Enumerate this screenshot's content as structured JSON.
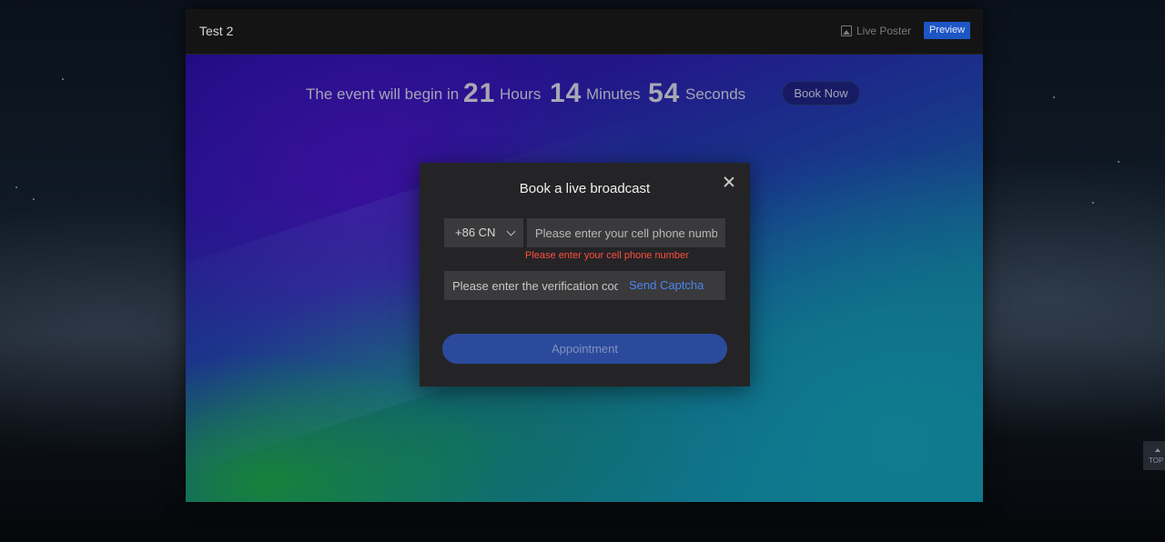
{
  "header": {
    "title": "Test 2",
    "poster_label": "Live Poster",
    "preview_label": "Preview"
  },
  "countdown": {
    "lead": "The event will begin in",
    "hours": "21",
    "hours_label": "Hours",
    "minutes": "14",
    "minutes_label": "Minutes",
    "seconds": "54",
    "seconds_label": "Seconds",
    "book_now_label": "Book Now"
  },
  "modal": {
    "title": "Book a live broadcast",
    "country_code": "+86 CN",
    "phone_placeholder": "Please enter your cell phone number",
    "phone_error": "Please enter your cell phone number",
    "code_placeholder": "Please enter the verification code",
    "send_captcha_label": "Send Captcha",
    "appointment_label": "Appointment"
  },
  "scroll_top": {
    "label": "TOP"
  },
  "colors": {
    "accent": "#1d55c4",
    "link": "#4a86ee",
    "error": "#ff4d3d",
    "appointment_bg": "#2b4a9c"
  },
  "icons": {
    "poster": "image-icon",
    "close": "close-icon",
    "dropdown": "chevron-down-icon",
    "scroll_top": "arrow-up-icon"
  }
}
